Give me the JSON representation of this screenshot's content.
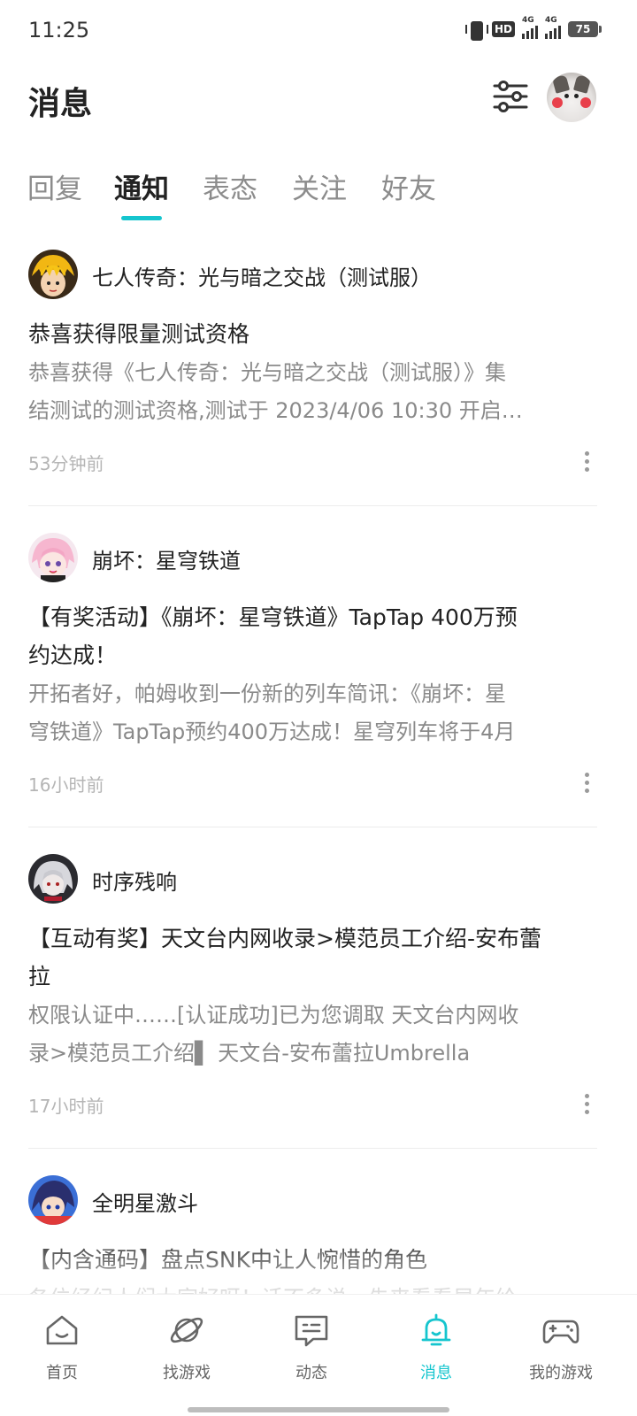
{
  "status_bar": {
    "time": "11:25",
    "hd_label": "HD",
    "network_1": "4G",
    "network_2": "4G",
    "battery": "75"
  },
  "header": {
    "title": "消息",
    "filter_icon": "sliders-icon",
    "avatar_icon": "cat-avatar"
  },
  "tabs": [
    {
      "label": "回复",
      "active": false
    },
    {
      "label": "通知",
      "active": true
    },
    {
      "label": "表态",
      "active": false
    },
    {
      "label": "关注",
      "active": false
    },
    {
      "label": "好友",
      "active": false
    }
  ],
  "notifications": [
    {
      "game": "七人传奇：光与暗之交战（测试服）",
      "title": "恭喜获得限量测试资格",
      "body_lines": [
        "恭喜获得《七人传奇：光与暗之交战（测试服）》集",
        "结测试的测试资格,测试于 2023/4/06 10:30 开启…"
      ],
      "time": "53分钟前"
    },
    {
      "game": "崩坏：星穹铁道",
      "title_lines": [
        "【有奖活动】《崩坏：星穹铁道》TapTap 400万预",
        "约达成！"
      ],
      "body_lines": [
        "开拓者好，帕姆收到一份新的列车简讯：《崩坏：星",
        "穹铁道》TapTap预约400万达成！星穹列车将于4月"
      ],
      "time": "16小时前"
    },
    {
      "game": "时序残响",
      "title_lines": [
        "【互动有奖】天文台内网收录>模范员工介绍-安布蕾",
        "拉"
      ],
      "body_lines": [
        "权限认证中……[认证成功]已为您调取 天文台内网收",
        "录>模范员工介绍▌ 天文台-安布蕾拉Umbrella"
      ],
      "time": "17小时前"
    },
    {
      "game": "全明星激斗",
      "title": "【内含通码】盘点SNK中让人惋惜的角色",
      "body_lines": [
        "各位经纪人们大家好呀！话不多说，先来看看早年给"
      ]
    }
  ],
  "bottom_nav": [
    {
      "label": "首页",
      "icon": "home-icon",
      "active": false
    },
    {
      "label": "找游戏",
      "icon": "planet-icon",
      "active": false
    },
    {
      "label": "动态",
      "icon": "chat-icon",
      "active": false
    },
    {
      "label": "消息",
      "icon": "bell-icon",
      "active": true
    },
    {
      "label": "我的游戏",
      "icon": "gamepad-icon",
      "active": false
    }
  ],
  "colors": {
    "accent": "#15c5ce",
    "text_primary": "#222222",
    "text_secondary": "#8a8a8a",
    "text_time": "#b5b5b5"
  }
}
